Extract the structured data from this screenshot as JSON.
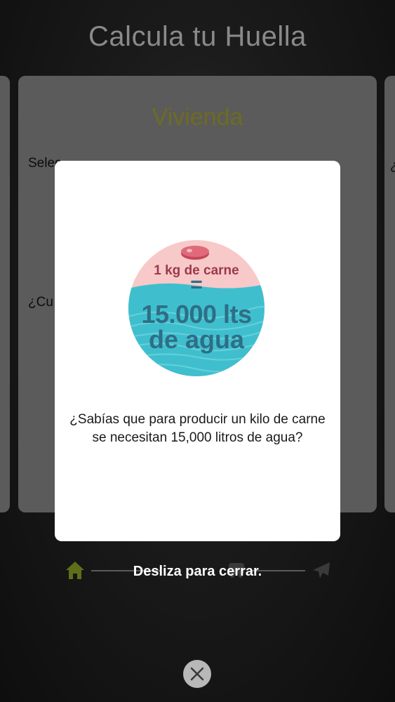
{
  "app": {
    "title": "Calcula tu Huella"
  },
  "card": {
    "heading": "Vivienda",
    "question_1_partial": "Selec",
    "question_2_partial": "¿Cu",
    "right_card_peek": "¿"
  },
  "nav": {
    "icons": [
      "home-icon",
      "car-icon",
      "plane-icon"
    ],
    "active_color": "#5e6e1a"
  },
  "modal": {
    "badge": {
      "line1": "1 kg de carne",
      "equals": "=",
      "line2": "15.000 lts",
      "line3": "de agua",
      "colors": {
        "top": "#f8c9c9",
        "water": "#3fbfce",
        "meat": "#c4475a",
        "text": "#2f6e86"
      }
    },
    "message": "¿Sabías que para producir un kilo de carne se necesitan 15,000 litros de agua?"
  },
  "swipe_hint": "Desliza para cerrar.",
  "close_button": {
    "icon": "close-icon"
  }
}
